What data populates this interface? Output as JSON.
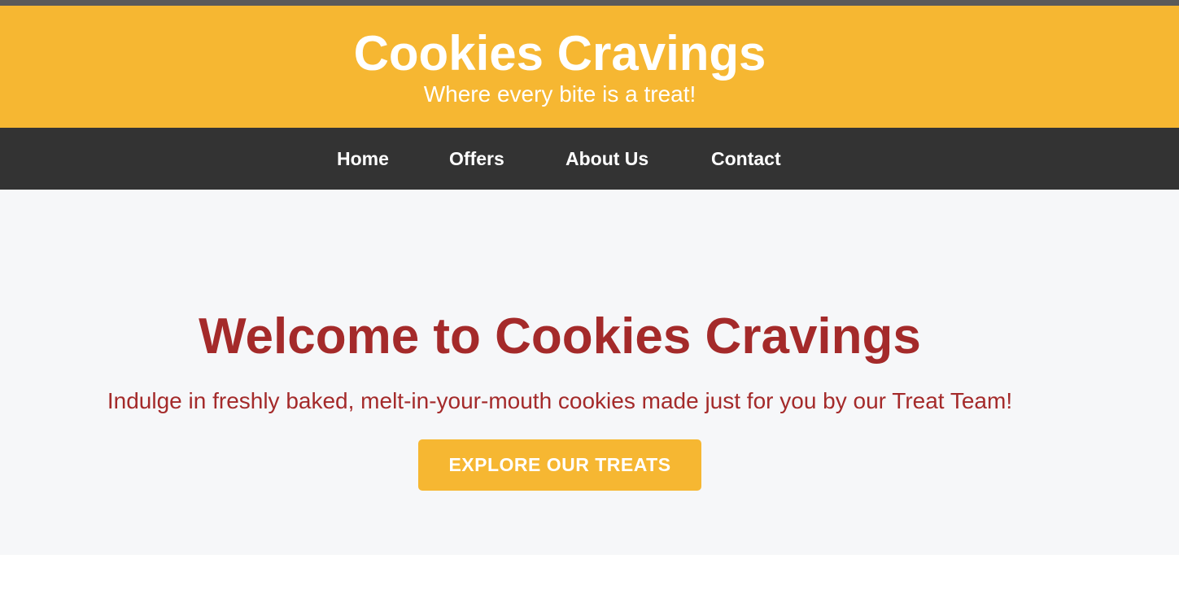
{
  "header": {
    "title": "Cookies Cravings",
    "tagline": "Where every bite is a treat!"
  },
  "nav": {
    "items": [
      {
        "label": "Home"
      },
      {
        "label": "Offers"
      },
      {
        "label": "About Us"
      },
      {
        "label": "Contact"
      }
    ]
  },
  "hero": {
    "title": "Welcome to Cookies Cravings",
    "text": "Indulge in freshly baked, melt-in-your-mouth cookies made just for you by our Treat Team!",
    "cta_label": "EXPLORE OUR TREATS"
  },
  "colors": {
    "brand_yellow": "#f6b732",
    "nav_dark": "#333333",
    "accent_red": "#a42a2a",
    "hero_background": "#f6f7f9"
  }
}
